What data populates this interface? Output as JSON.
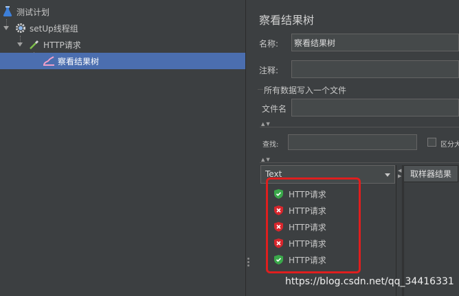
{
  "tree": {
    "items": [
      {
        "label": "测试计划",
        "icon": "flask-icon"
      },
      {
        "label": "setUp线程组",
        "icon": "gear-icon"
      },
      {
        "label": "HTTP请求",
        "icon": "pipette-icon"
      },
      {
        "label": "察看结果树",
        "icon": "chart-icon"
      }
    ]
  },
  "panel": {
    "title": "察看结果树",
    "name_label": "名称:",
    "name_value": "察看结果树",
    "comment_label": "注释:",
    "file_section_label": "所有数据写入一个文件",
    "filename_label": "文件名",
    "search_label": "查找:",
    "case_label": "区分大"
  },
  "results": {
    "render_select": "Text",
    "tab_label": "取样器结果",
    "items": [
      {
        "label": "HTTP请求",
        "status": "success"
      },
      {
        "label": "HTTP请求",
        "status": "error"
      },
      {
        "label": "HTTP请求",
        "status": "error"
      },
      {
        "label": "HTTP请求",
        "status": "error"
      },
      {
        "label": "HTTP请求",
        "status": "success"
      }
    ]
  },
  "colors": {
    "success": "#3aa84a",
    "error": "#d9262c",
    "selection": "#4b6eaf",
    "highlight": "#e01e1e"
  },
  "watermark": "https://blog.csdn.net/qq_34416331"
}
